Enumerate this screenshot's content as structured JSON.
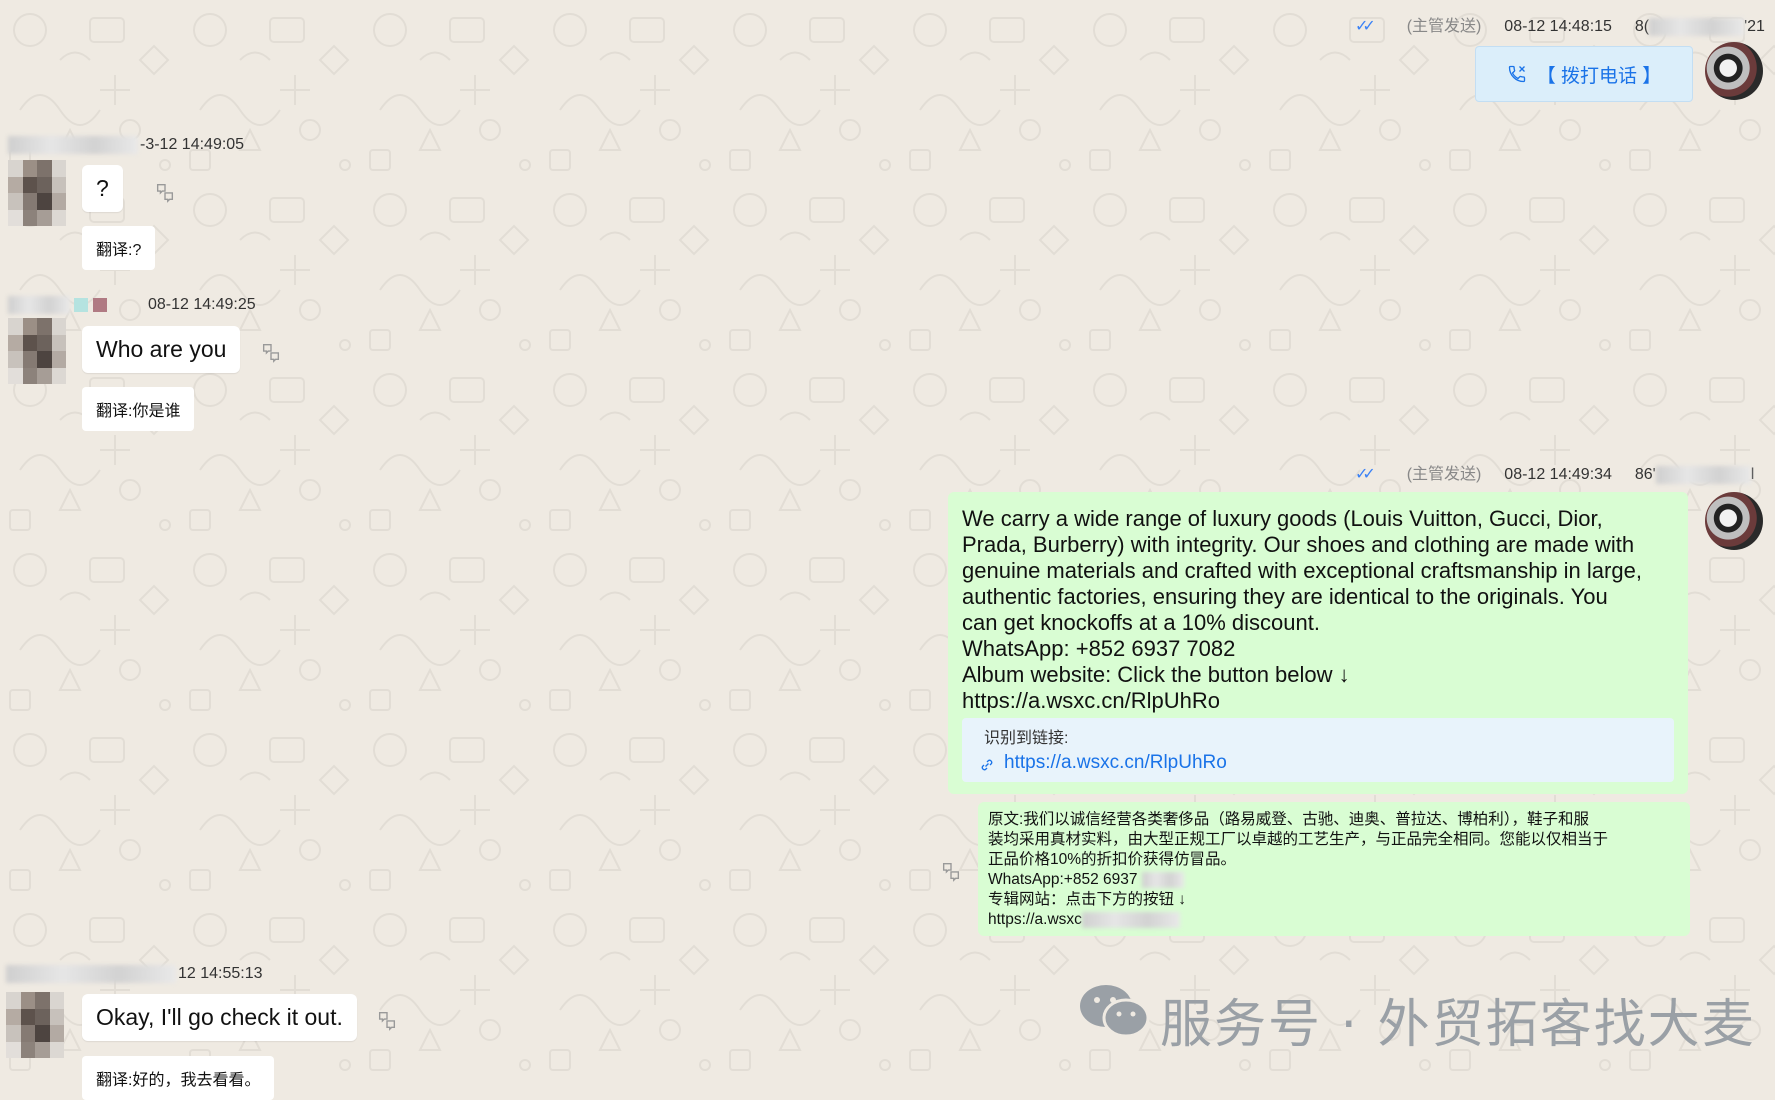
{
  "messages": {
    "out1": {
      "ticks": "✓✓",
      "sender_tag": "(主管发送)",
      "time": "08-12 14:48:15",
      "phone_prefix": "8(",
      "phone_suffix": "'21",
      "call_label": "【 拨打电话 】"
    },
    "in1": {
      "time": "-3-12 14:49:05",
      "text": "?",
      "translation": "翻译:?"
    },
    "in2": {
      "time": "08-12 14:49:25",
      "text": "Who are you",
      "translation": "翻译:你是谁"
    },
    "out2": {
      "ticks": "✓✓",
      "sender_tag": "(主管发送)",
      "time": "08-12 14:49:34",
      "phone_prefix": "86'",
      "phone_suffix": "l",
      "text_lines": [
        "We carry a wide range of luxury goods (Louis Vuitton, Gucci, Dior,",
        "Prada, Burberry) with integrity. Our shoes and clothing are made with",
        "genuine materials and crafted with exceptional craftsmanship in large,",
        "authentic factories, ensuring they are identical to the originals. You",
        "can get knockoffs at a 10% discount.",
        "WhatsApp: +852 6937 7082",
        "Album website: Click the button below ↓",
        "https://a.wsxc.cn/RlpUhRo"
      ],
      "link_detected_label": "识别到链接:",
      "link_url": "https://a.wsxc.cn/RlpUhRo",
      "translation_lines": [
        "原文:我们以诚信经营各类奢侈品（路易威登、古驰、迪奥、普拉达、博柏利），鞋子和服",
        "装均采用真材实料，由大型正规工厂以卓越的工艺生产，与正品完全相同。您能以仅相当于",
        "正品价格10%的折扣价获得仿冒品。",
        "WhatsApp:+852 6937",
        "专辑网站：点击下方的按钮 ↓",
        "https://a.wsxc"
      ]
    },
    "in3": {
      "time": "12 14:55:13",
      "text": "Okay, I'll go check it out.",
      "translation": "翻译:好的，我去看看。"
    }
  },
  "watermark": {
    "text": "服务号 · 外贸拓客找大麦"
  },
  "colors": {
    "background": "#efeae2",
    "outgoing_bubble": "#d9fdd3",
    "incoming_bubble": "#ffffff",
    "link": "#1a73e8",
    "tick": "#3b82f6",
    "call_button_bg": "#dbeefa"
  }
}
